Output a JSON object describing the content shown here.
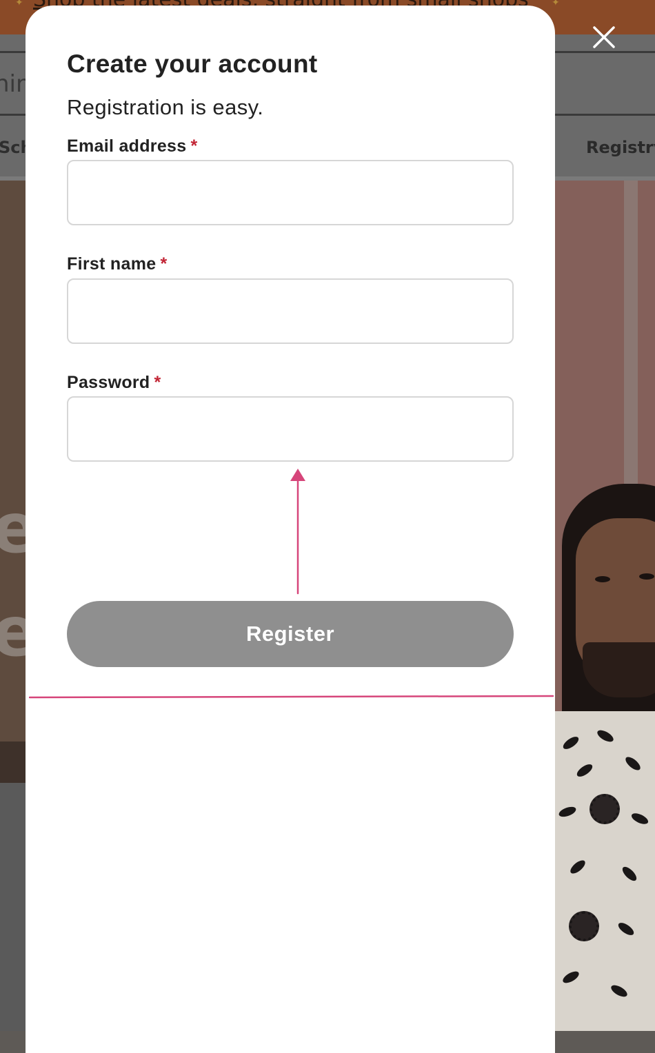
{
  "background": {
    "banner_text": "Shop the latest deals, straight from small shops",
    "search_fragment": "hin",
    "nav_left_fragment": "Sch",
    "nav_right_label": "Registry",
    "hero_fragment_line1": "e",
    "hero_fragment_line2": "e"
  },
  "modal": {
    "title": "Create your account",
    "subtitle": "Registration is easy.",
    "required_marker": "*",
    "fields": [
      {
        "label": "Email address",
        "value": "",
        "placeholder": ""
      },
      {
        "label": "First name",
        "value": "",
        "placeholder": ""
      },
      {
        "label": "Password",
        "value": "",
        "placeholder": ""
      }
    ],
    "register_label": "Register"
  },
  "colors": {
    "register_button": "#8f8f8f",
    "required_marker": "#c22535",
    "annotation": "#d6457a",
    "banner": "#8a4a27"
  },
  "icons": {
    "close": "close-icon",
    "annotation_arrow": "arrow-up-icon"
  }
}
